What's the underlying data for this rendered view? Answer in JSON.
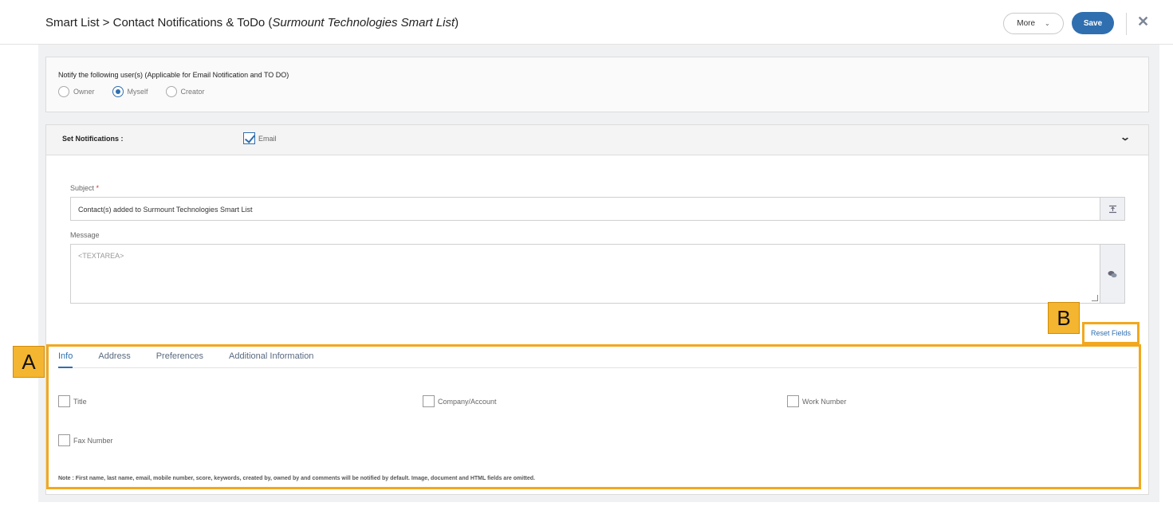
{
  "header": {
    "breadcrumb_prefix": "Smart List > Contact Notifications & ToDo (",
    "breadcrumb_list_name": "Surmount Technologies Smart List",
    "breadcrumb_suffix": ")",
    "more_label": "More",
    "save_label": "Save",
    "close_glyph": "✕"
  },
  "notify": {
    "label": "Notify the following user(s) (Applicable for Email Notification and TO DO)",
    "options": [
      {
        "label": "Owner",
        "selected": false
      },
      {
        "label": "Myself",
        "selected": true
      },
      {
        "label": "Creator",
        "selected": false
      }
    ]
  },
  "notifications": {
    "label": "Set Notifications :",
    "email_label": "Email",
    "email_checked": true
  },
  "form": {
    "subject_label": "Subject",
    "required_mark": "*",
    "subject_value": "Contact(s) added to Surmount Technologies Smart List",
    "message_label": "Message",
    "message_placeholder": "<TEXTAREA>",
    "subject_addon_icon": "insert-field-icon",
    "message_addon_icon": "chat-bubbles-icon"
  },
  "reset_fields_label": "Reset Fields",
  "markers": {
    "a": "A",
    "b": "B"
  },
  "tabs": [
    {
      "label": "Info",
      "active": true
    },
    {
      "label": "Address",
      "active": false
    },
    {
      "label": "Preferences",
      "active": false
    },
    {
      "label": "Additional Information",
      "active": false
    }
  ],
  "fields": [
    {
      "label": "Title",
      "checked": false
    },
    {
      "label": "Company/Account",
      "checked": false
    },
    {
      "label": "Work Number",
      "checked": false
    },
    {
      "label": "Fax Number",
      "checked": false
    }
  ],
  "note": "Note : First name, last name, email, mobile number, score, keywords, created by, owned by and comments will be notified by default. Image, document and HTML fields are omitted.",
  "colors": {
    "accent": "#2f6fb0",
    "highlight": "#f2a81d"
  }
}
